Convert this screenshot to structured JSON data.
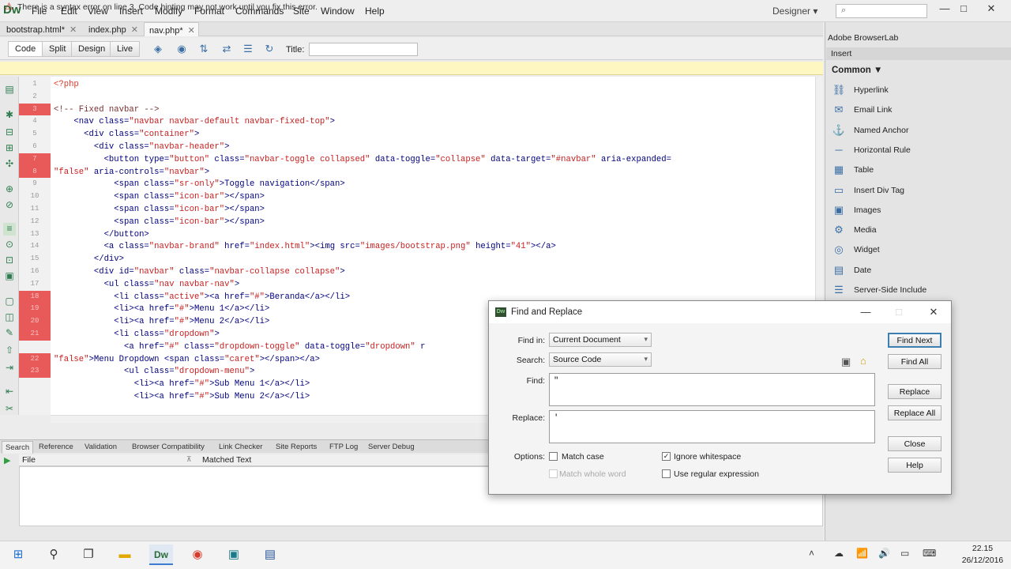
{
  "app": {
    "logo": "Dw",
    "menu": [
      "File",
      "Edit",
      "View",
      "Insert",
      "Modify",
      "Format",
      "Commands",
      "Site",
      "Window",
      "Help"
    ],
    "workspace": "Designer ▾",
    "search_icon": "⌕"
  },
  "window_controls": {
    "minimize": "—",
    "maximize": "□",
    "close": "✕"
  },
  "doc_tabs": [
    {
      "label": "bootstrap.html*",
      "close": "✕"
    },
    {
      "label": "index.php",
      "close": "✕"
    },
    {
      "label": "nav.php*",
      "close": "✕"
    }
  ],
  "doc_toolbar": {
    "views": [
      "Code",
      "Split",
      "Design",
      "Live"
    ],
    "title_label": "Title:",
    "title_value": ""
  },
  "warning": {
    "icon": "⚠",
    "text": "There is a syntax error on line 3.  Code hinting may not work until you fix this error."
  },
  "editor": {
    "line_numbers": [
      "1",
      "2",
      "3",
      "4",
      "5",
      "6",
      "7",
      "8",
      "9",
      "10",
      "11",
      "12",
      "13",
      "14",
      "15",
      "16",
      "17",
      "18",
      "19",
      "20",
      "21",
      "",
      "22",
      "23"
    ],
    "error_line_indexes": [
      2,
      6,
      7,
      17,
      18,
      19,
      20,
      22,
      23
    ],
    "lines": [
      [
        {
          "t": "<?php",
          "c": "php"
        }
      ],
      [
        {
          "t": "",
          "c": "tag"
        }
      ],
      [
        {
          "t": "<!-- Fixed navbar -->",
          "c": "com"
        }
      ],
      [
        {
          "t": "    <nav class=",
          "c": "tag"
        },
        {
          "t": "\"navbar navbar-default navbar-fixed-top\"",
          "c": "str"
        },
        {
          "t": ">",
          "c": "tag"
        }
      ],
      [
        {
          "t": "      <div class=",
          "c": "tag"
        },
        {
          "t": "\"container\"",
          "c": "str"
        },
        {
          "t": ">",
          "c": "tag"
        }
      ],
      [
        {
          "t": "        <div class=",
          "c": "tag"
        },
        {
          "t": "\"navbar-header\"",
          "c": "str"
        },
        {
          "t": ">",
          "c": "tag"
        }
      ],
      [
        {
          "t": "          <button type=",
          "c": "tag"
        },
        {
          "t": "\"button\"",
          "c": "str"
        },
        {
          "t": " class=",
          "c": "tag"
        },
        {
          "t": "\"navbar-toggle collapsed\"",
          "c": "str"
        },
        {
          "t": " data-toggle=",
          "c": "tag"
        },
        {
          "t": "\"collapse\"",
          "c": "str"
        },
        {
          "t": " data-target=",
          "c": "tag"
        },
        {
          "t": "\"#navbar\"",
          "c": "str"
        },
        {
          "t": " aria-expanded=",
          "c": "tag"
        }
      ],
      [
        {
          "t": "\"false\"",
          "c": "str"
        },
        {
          "t": " aria-controls=",
          "c": "tag"
        },
        {
          "t": "\"navbar\"",
          "c": "str"
        },
        {
          "t": ">",
          "c": "tag"
        }
      ],
      [
        {
          "t": "            <span class=",
          "c": "tag"
        },
        {
          "t": "\"sr-only\"",
          "c": "str"
        },
        {
          "t": ">Toggle navigation</span>",
          "c": "tag"
        }
      ],
      [
        {
          "t": "            <span class=",
          "c": "tag"
        },
        {
          "t": "\"icon-bar\"",
          "c": "str"
        },
        {
          "t": "></span>",
          "c": "tag"
        }
      ],
      [
        {
          "t": "            <span class=",
          "c": "tag"
        },
        {
          "t": "\"icon-bar\"",
          "c": "str"
        },
        {
          "t": "></span>",
          "c": "tag"
        }
      ],
      [
        {
          "t": "            <span class=",
          "c": "tag"
        },
        {
          "t": "\"icon-bar\"",
          "c": "str"
        },
        {
          "t": "></span>",
          "c": "tag"
        }
      ],
      [
        {
          "t": "          </button>",
          "c": "tag"
        }
      ],
      [
        {
          "t": "          <a class=",
          "c": "tag"
        },
        {
          "t": "\"navbar-brand\"",
          "c": "str"
        },
        {
          "t": " href=",
          "c": "tag"
        },
        {
          "t": "\"index.html\"",
          "c": "str"
        },
        {
          "t": "><img src=",
          "c": "tag"
        },
        {
          "t": "\"images/bootstrap.png\"",
          "c": "str"
        },
        {
          "t": " height=",
          "c": "tag"
        },
        {
          "t": "\"41\"",
          "c": "str"
        },
        {
          "t": "></a>",
          "c": "tag"
        }
      ],
      [
        {
          "t": "        </div>",
          "c": "tag"
        }
      ],
      [
        {
          "t": "        <div id=",
          "c": "tag"
        },
        {
          "t": "\"navbar\"",
          "c": "str"
        },
        {
          "t": " class=",
          "c": "tag"
        },
        {
          "t": "\"navbar-collapse collapse\"",
          "c": "str"
        },
        {
          "t": ">",
          "c": "tag"
        }
      ],
      [
        {
          "t": "          <ul class=",
          "c": "tag"
        },
        {
          "t": "\"nav navbar-nav\"",
          "c": "str"
        },
        {
          "t": ">",
          "c": "tag"
        }
      ],
      [
        {
          "t": "            <li class=",
          "c": "tag"
        },
        {
          "t": "\"active\"",
          "c": "str"
        },
        {
          "t": "><a href=",
          "c": "tag"
        },
        {
          "t": "\"#\"",
          "c": "str"
        },
        {
          "t": ">Beranda</a></li>",
          "c": "tag"
        }
      ],
      [
        {
          "t": "            <li><a href=",
          "c": "tag"
        },
        {
          "t": "\"#\"",
          "c": "str"
        },
        {
          "t": ">Menu 1</a></li>",
          "c": "tag"
        }
      ],
      [
        {
          "t": "            <li><a href=",
          "c": "tag"
        },
        {
          "t": "\"#\"",
          "c": "str"
        },
        {
          "t": ">Menu 2</a></li>",
          "c": "tag"
        }
      ],
      [
        {
          "t": "            <li class=",
          "c": "tag"
        },
        {
          "t": "\"dropdown\"",
          "c": "str"
        },
        {
          "t": ">",
          "c": "tag"
        }
      ],
      [
        {
          "t": "              <a href=",
          "c": "tag"
        },
        {
          "t": "\"#\"",
          "c": "str"
        },
        {
          "t": " class=",
          "c": "tag"
        },
        {
          "t": "\"dropdown-toggle\"",
          "c": "str"
        },
        {
          "t": " data-toggle=",
          "c": "tag"
        },
        {
          "t": "\"dropdown\"",
          "c": "str"
        },
        {
          "t": " r",
          "c": "tag"
        }
      ],
      [
        {
          "t": "\"false\"",
          "c": "str"
        },
        {
          "t": ">Menu Dropdown <span class=",
          "c": "tag"
        },
        {
          "t": "\"caret\"",
          "c": "str"
        },
        {
          "t": "></span></a>",
          "c": "tag"
        }
      ],
      [
        {
          "t": "              <ul class=",
          "c": "tag"
        },
        {
          "t": "\"dropdown-menu\"",
          "c": "str"
        },
        {
          "t": ">",
          "c": "tag"
        }
      ],
      [
        {
          "t": "                <li><a href=",
          "c": "tag"
        },
        {
          "t": "\"#\"",
          "c": "str"
        },
        {
          "t": ">Sub Menu 1</a></li>",
          "c": "tag"
        }
      ],
      [
        {
          "t": "                <li><a href=",
          "c": "tag"
        },
        {
          "t": "\"#\"",
          "c": "str"
        },
        {
          "t": ">Sub Menu 2</a></li>",
          "c": "tag"
        }
      ]
    ]
  },
  "results_panel": {
    "tabs": [
      "Search",
      "Reference",
      "Validation",
      "Browser Compatibility",
      "Link Checker",
      "Site Reports",
      "FTP Log",
      "Server Debug"
    ],
    "columns": [
      "File",
      "Matched Text"
    ]
  },
  "right_panel": {
    "browserlab_tab": "Adobe BrowserLab",
    "insert_header": "Insert",
    "category": "Common ▼",
    "items": [
      {
        "label": "Hyperlink",
        "icon": "link-icon",
        "glyph": "⛓"
      },
      {
        "label": "Email Link",
        "icon": "email-icon",
        "glyph": "✉"
      },
      {
        "label": "Named Anchor",
        "icon": "anchor-icon",
        "glyph": "⚓"
      },
      {
        "label": "Horizontal Rule",
        "icon": "rule-icon",
        "glyph": "─"
      },
      {
        "label": "Table",
        "icon": "table-icon",
        "glyph": "▦"
      },
      {
        "label": "Insert Div Tag",
        "icon": "div-icon",
        "glyph": "▭"
      },
      {
        "label": "Images",
        "icon": "images-icon",
        "glyph": "▣"
      },
      {
        "label": "Media",
        "icon": "media-icon",
        "glyph": "⚙"
      },
      {
        "label": "Widget",
        "icon": "widget-icon",
        "glyph": "◎"
      },
      {
        "label": "Date",
        "icon": "date-icon",
        "glyph": "▤"
      },
      {
        "label": "Server-Side Include",
        "icon": "ssi-icon",
        "glyph": "☰"
      }
    ]
  },
  "dialog": {
    "icon_text": "Dw",
    "title": "Find and Replace",
    "find_in_label": "Find in:",
    "find_in_value": "Current Document",
    "search_label": "Search:",
    "search_value": "Source Code",
    "find_label": "Find:",
    "find_value": "\"",
    "replace_label": "Replace:",
    "replace_value": "'",
    "options_label": "Options:",
    "match_case": "Match case",
    "match_whole_word": "Match whole word",
    "ignore_whitespace": "Ignore whitespace",
    "use_regex": "Use regular expression",
    "ignore_whitespace_checked": "✓",
    "buttons": [
      "Find Next",
      "Find All",
      "Replace",
      "Replace All",
      "Close",
      "Help"
    ]
  },
  "taskbar": {
    "clock_time": "22.15",
    "clock_date": "26/12/2016"
  },
  "colors": {
    "error_gutter": "#e85a5a",
    "string": "#c81e1e",
    "tag": "#00007f",
    "warning_bg": "#fff7c2",
    "accent": "#3c7fb1"
  }
}
